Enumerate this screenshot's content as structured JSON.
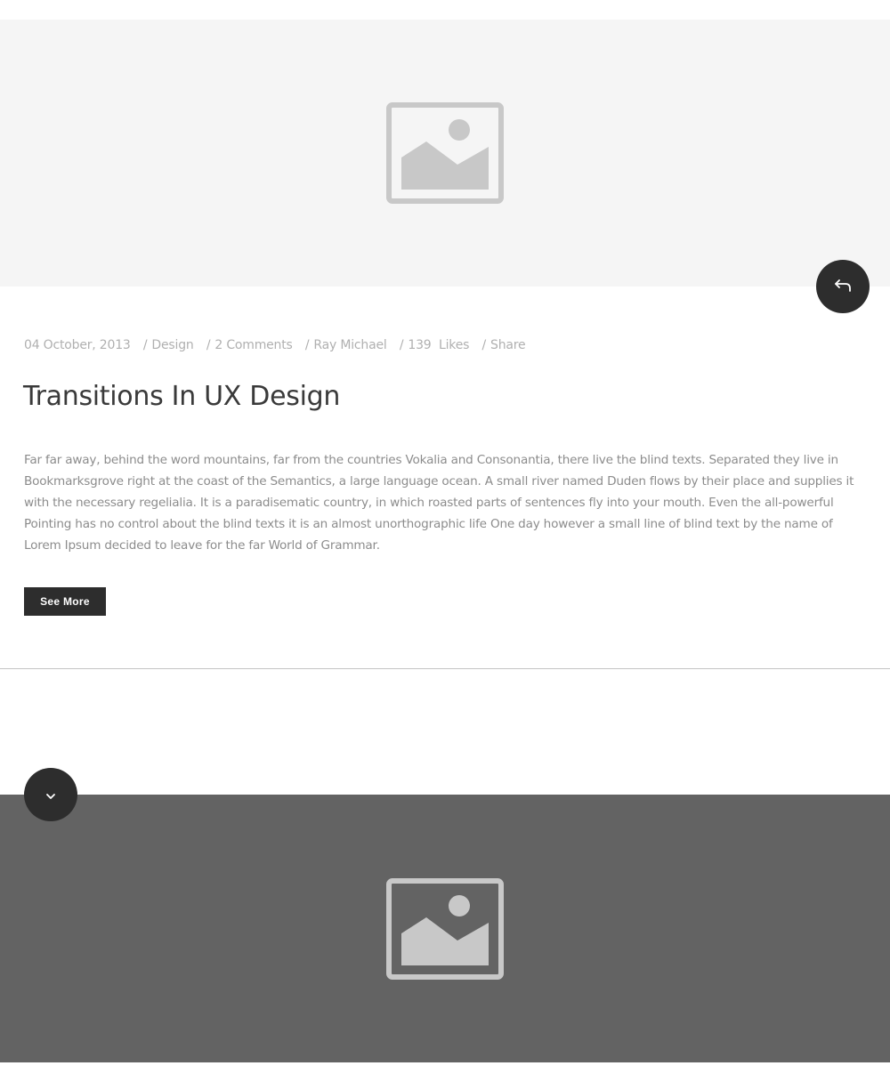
{
  "post": {
    "meta": {
      "date": "04 October, 2013",
      "category": "Design",
      "comments": "2 Comments",
      "author": "Ray Michael",
      "likes_count": "139",
      "likes_label": "Likes",
      "share": "Share",
      "separator": "/"
    },
    "title": "Transitions In UX Design",
    "excerpt": "Far far away, behind the word mountains, far from the countries Vokalia and Consonantia, there live the blind texts. Separated they live in Bookmarksgrove right at the coast of the Semantics, a large language ocean. A small river named Duden flows by their place and supplies it with the necessary regelialia. It is a paradisematic country, in which roasted parts of sentences fly into your mouth. Even the all-powerful Pointing has no control about the blind texts it is an almost unorthographic life One day however a small line of blind text by the name of Lorem Ipsum decided to leave for the far World of Grammar.",
    "see_more_label": "See More"
  },
  "icons": {
    "reply": "reply-icon",
    "chevron": "chevron-down-icon",
    "image": "image-placeholder-icon"
  },
  "colors": {
    "hero_light_bg": "#f5f5f5",
    "hero_dark_bg": "#636363",
    "button_dark": "#2d2d2d",
    "placeholder_gray": "#c8c8c8",
    "meta_text": "#b0b0b0",
    "title_text": "#3a3a3a",
    "body_text": "#8c8c8c"
  }
}
